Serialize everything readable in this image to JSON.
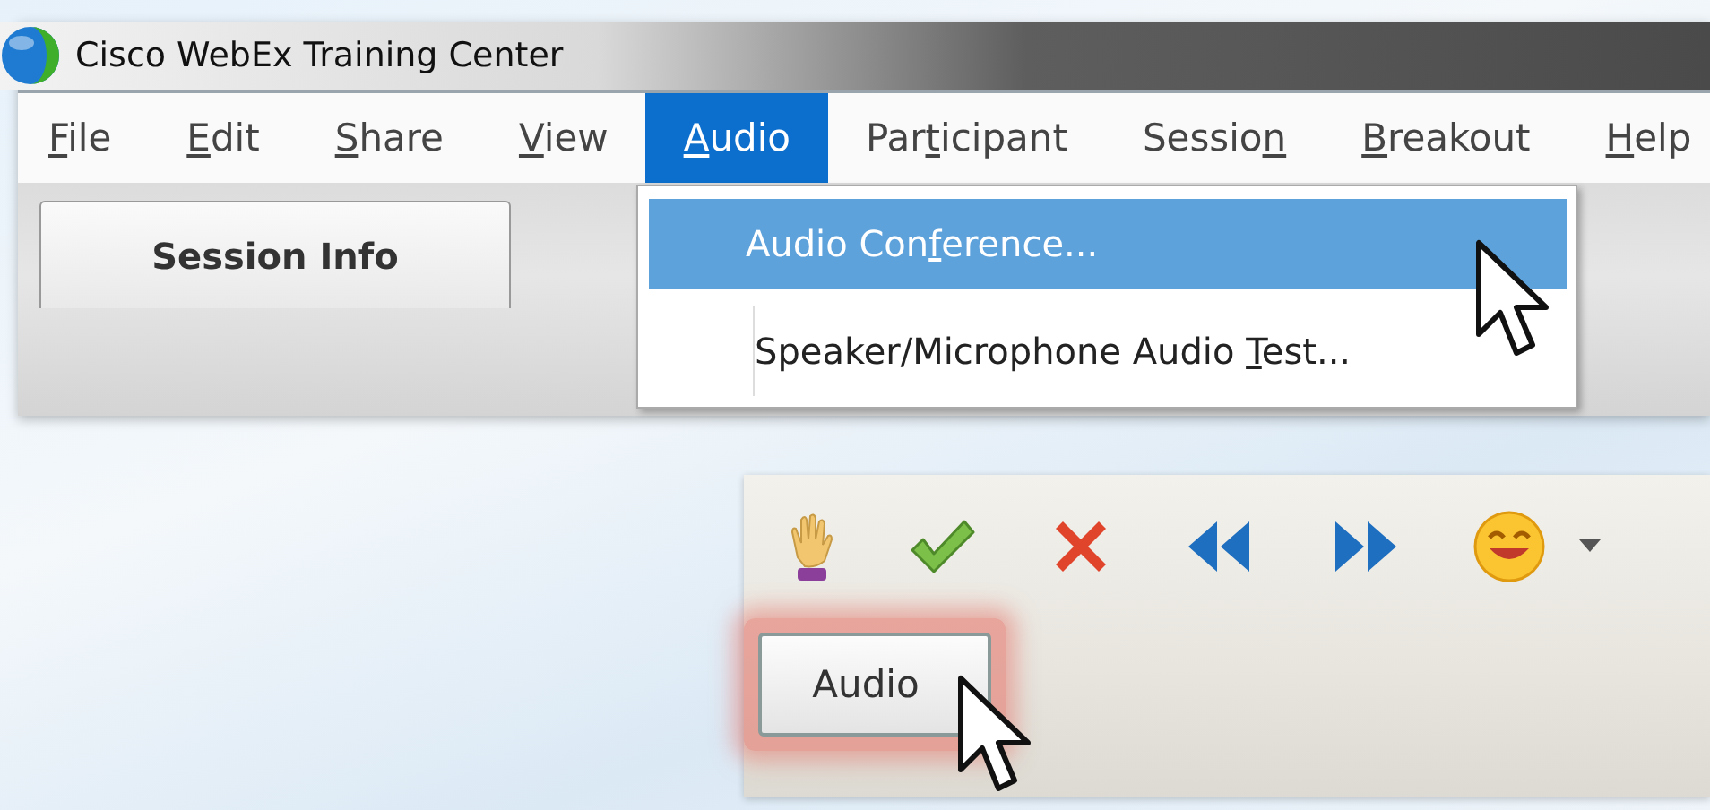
{
  "window": {
    "title": "Cisco WebEx Training Center"
  },
  "menu_bar": [
    {
      "label_parts": [
        {
          "text": "F",
          "underlined": true
        },
        {
          "text": "ile",
          "underlined": false
        }
      ],
      "selected": false
    },
    {
      "label_parts": [
        {
          "text": "E",
          "underlined": true
        },
        {
          "text": "dit",
          "underlined": false
        }
      ],
      "selected": false
    },
    {
      "label_parts": [
        {
          "text": "S",
          "underlined": true
        },
        {
          "text": "hare",
          "underlined": false
        }
      ],
      "selected": false
    },
    {
      "label_parts": [
        {
          "text": "V",
          "underlined": true
        },
        {
          "text": "iew",
          "underlined": false
        }
      ],
      "selected": false
    },
    {
      "label_parts": [
        {
          "text": "A",
          "underlined": true
        },
        {
          "text": "udio",
          "underlined": false
        }
      ],
      "selected": true
    },
    {
      "label_parts": [
        {
          "text": "Par",
          "underlined": false
        },
        {
          "text": "t",
          "underlined": true
        },
        {
          "text": "icipant",
          "underlined": false
        }
      ],
      "selected": false
    },
    {
      "label_parts": [
        {
          "text": "Sessio",
          "underlined": false
        },
        {
          "text": "n",
          "underlined": true
        }
      ],
      "selected": false
    },
    {
      "label_parts": [
        {
          "text": "B",
          "underlined": true
        },
        {
          "text": "reakout",
          "underlined": false
        }
      ],
      "selected": false
    },
    {
      "label_parts": [
        {
          "text": "H",
          "underlined": true
        },
        {
          "text": "elp",
          "underlined": false
        }
      ],
      "selected": false
    }
  ],
  "open_menu": {
    "items": [
      {
        "label_parts": [
          {
            "text": "Audio Con",
            "underlined": false
          },
          {
            "text": "f",
            "underlined": true
          },
          {
            "text": "erence...",
            "underlined": false
          }
        ],
        "selected": true
      },
      {
        "label_parts": [
          {
            "text": "Speaker/Microphone Audio ",
            "underlined": false
          },
          {
            "text": "T",
            "underlined": true
          },
          {
            "text": "est...",
            "underlined": false
          }
        ],
        "selected": false
      }
    ]
  },
  "tabs": [
    {
      "label": "Session Info",
      "selected": true
    }
  ],
  "toolbar": {
    "tools": [
      {
        "kind": "hand"
      },
      {
        "kind": "check"
      },
      {
        "kind": "cross"
      },
      {
        "kind": "rewind"
      },
      {
        "kind": "forward"
      },
      {
        "kind": "smiley"
      },
      {
        "kind": "caret"
      }
    ],
    "audio_button": {
      "label": "Audio",
      "highlighted": true
    }
  }
}
